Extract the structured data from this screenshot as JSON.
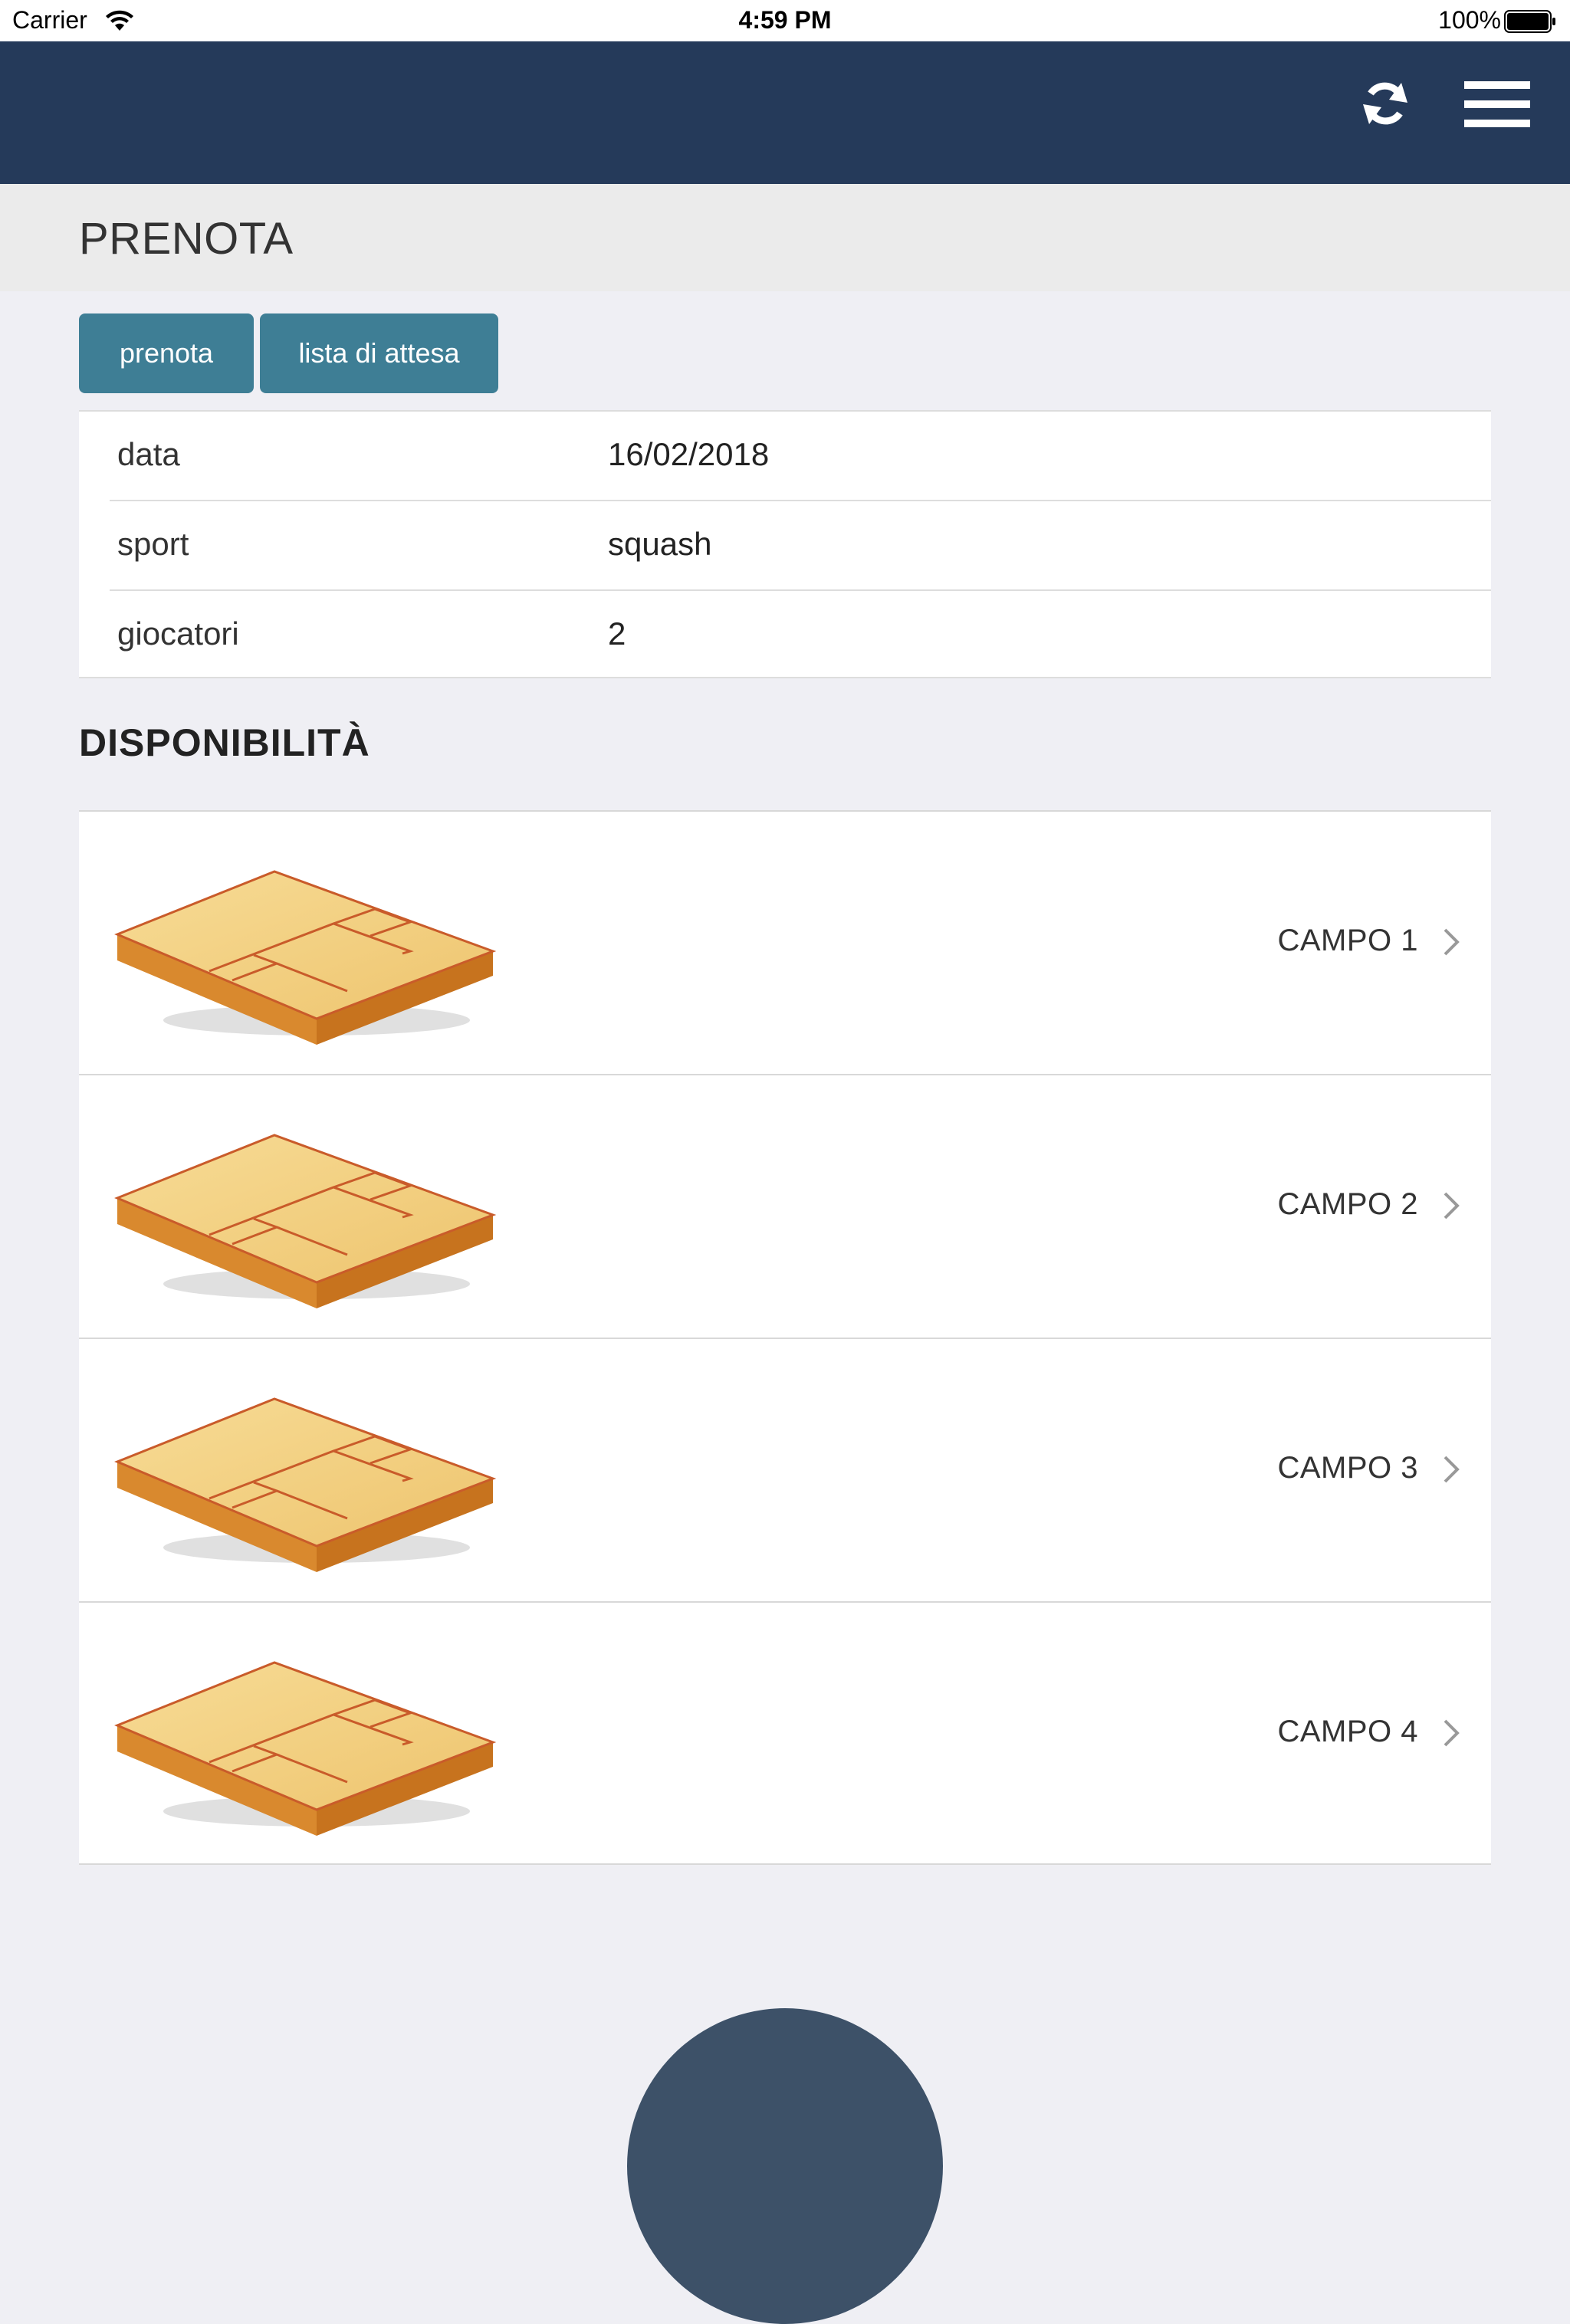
{
  "status_bar": {
    "carrier": "Carrier",
    "time": "4:59 PM",
    "battery": "100%"
  },
  "nav": {
    "background": "#253a5a",
    "icons": [
      "refresh-icon",
      "hamburger-menu-icon"
    ]
  },
  "page": {
    "title": "PRENOTA"
  },
  "tabs": {
    "prenota_label": "prenota",
    "lista_label": "lista di attesa"
  },
  "form": {
    "rows": [
      {
        "label": "data",
        "value": "16/02/2018"
      },
      {
        "label": "sport",
        "value": "squash"
      },
      {
        "label": "giocatori",
        "value": "2"
      }
    ]
  },
  "availability": {
    "title": "DISPONIBILITÀ",
    "courts": [
      {
        "label": "CAMPO 1"
      },
      {
        "label": "CAMPO 2"
      },
      {
        "label": "CAMPO 3"
      },
      {
        "label": "CAMPO 4"
      }
    ]
  },
  "colors": {
    "accent_button": "#3e7e95",
    "fab": "#3d5168",
    "background": "#efeff4"
  }
}
